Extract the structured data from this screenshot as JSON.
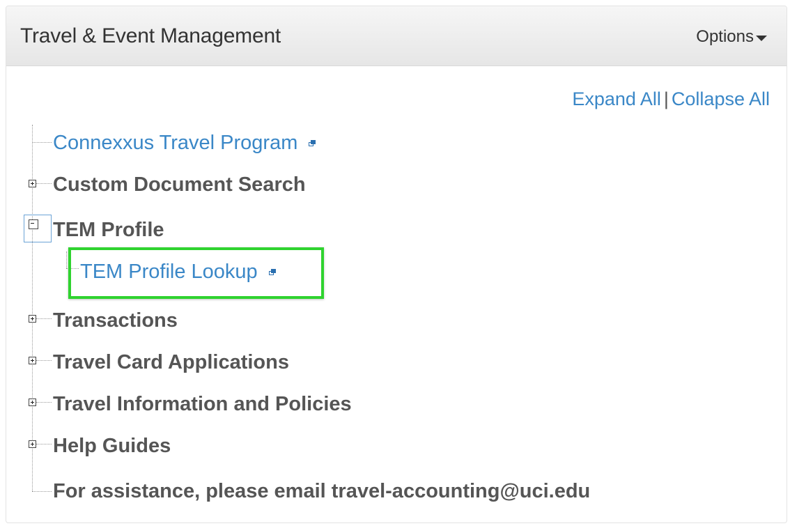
{
  "header": {
    "title": "Travel & Event Management",
    "options_label": "Options"
  },
  "tree_controls": {
    "expand_all": "Expand All",
    "separator": "|",
    "collapse_all": "Collapse All"
  },
  "tree": {
    "items": [
      {
        "label": "Connexxus Travel Program",
        "type": "link",
        "external": true
      },
      {
        "label": "Custom Document Search",
        "type": "folder",
        "state": "collapsed"
      },
      {
        "label": "TEM Profile",
        "type": "folder",
        "state": "expanded",
        "children": [
          {
            "label": "TEM Profile Lookup",
            "type": "link",
            "external": true,
            "highlighted": true
          }
        ]
      },
      {
        "label": "Transactions",
        "type": "folder",
        "state": "collapsed"
      },
      {
        "label": "Travel Card Applications",
        "type": "folder",
        "state": "collapsed"
      },
      {
        "label": "Travel Information and Policies",
        "type": "folder",
        "state": "collapsed"
      },
      {
        "label": "Help Guides",
        "type": "folder",
        "state": "collapsed"
      },
      {
        "label": "For assistance, please email travel-accounting@uci.edu",
        "type": "text"
      }
    ]
  },
  "colors": {
    "link": "#3a87c7",
    "folder_text": "#555555",
    "highlight_border": "#2fd32f"
  }
}
